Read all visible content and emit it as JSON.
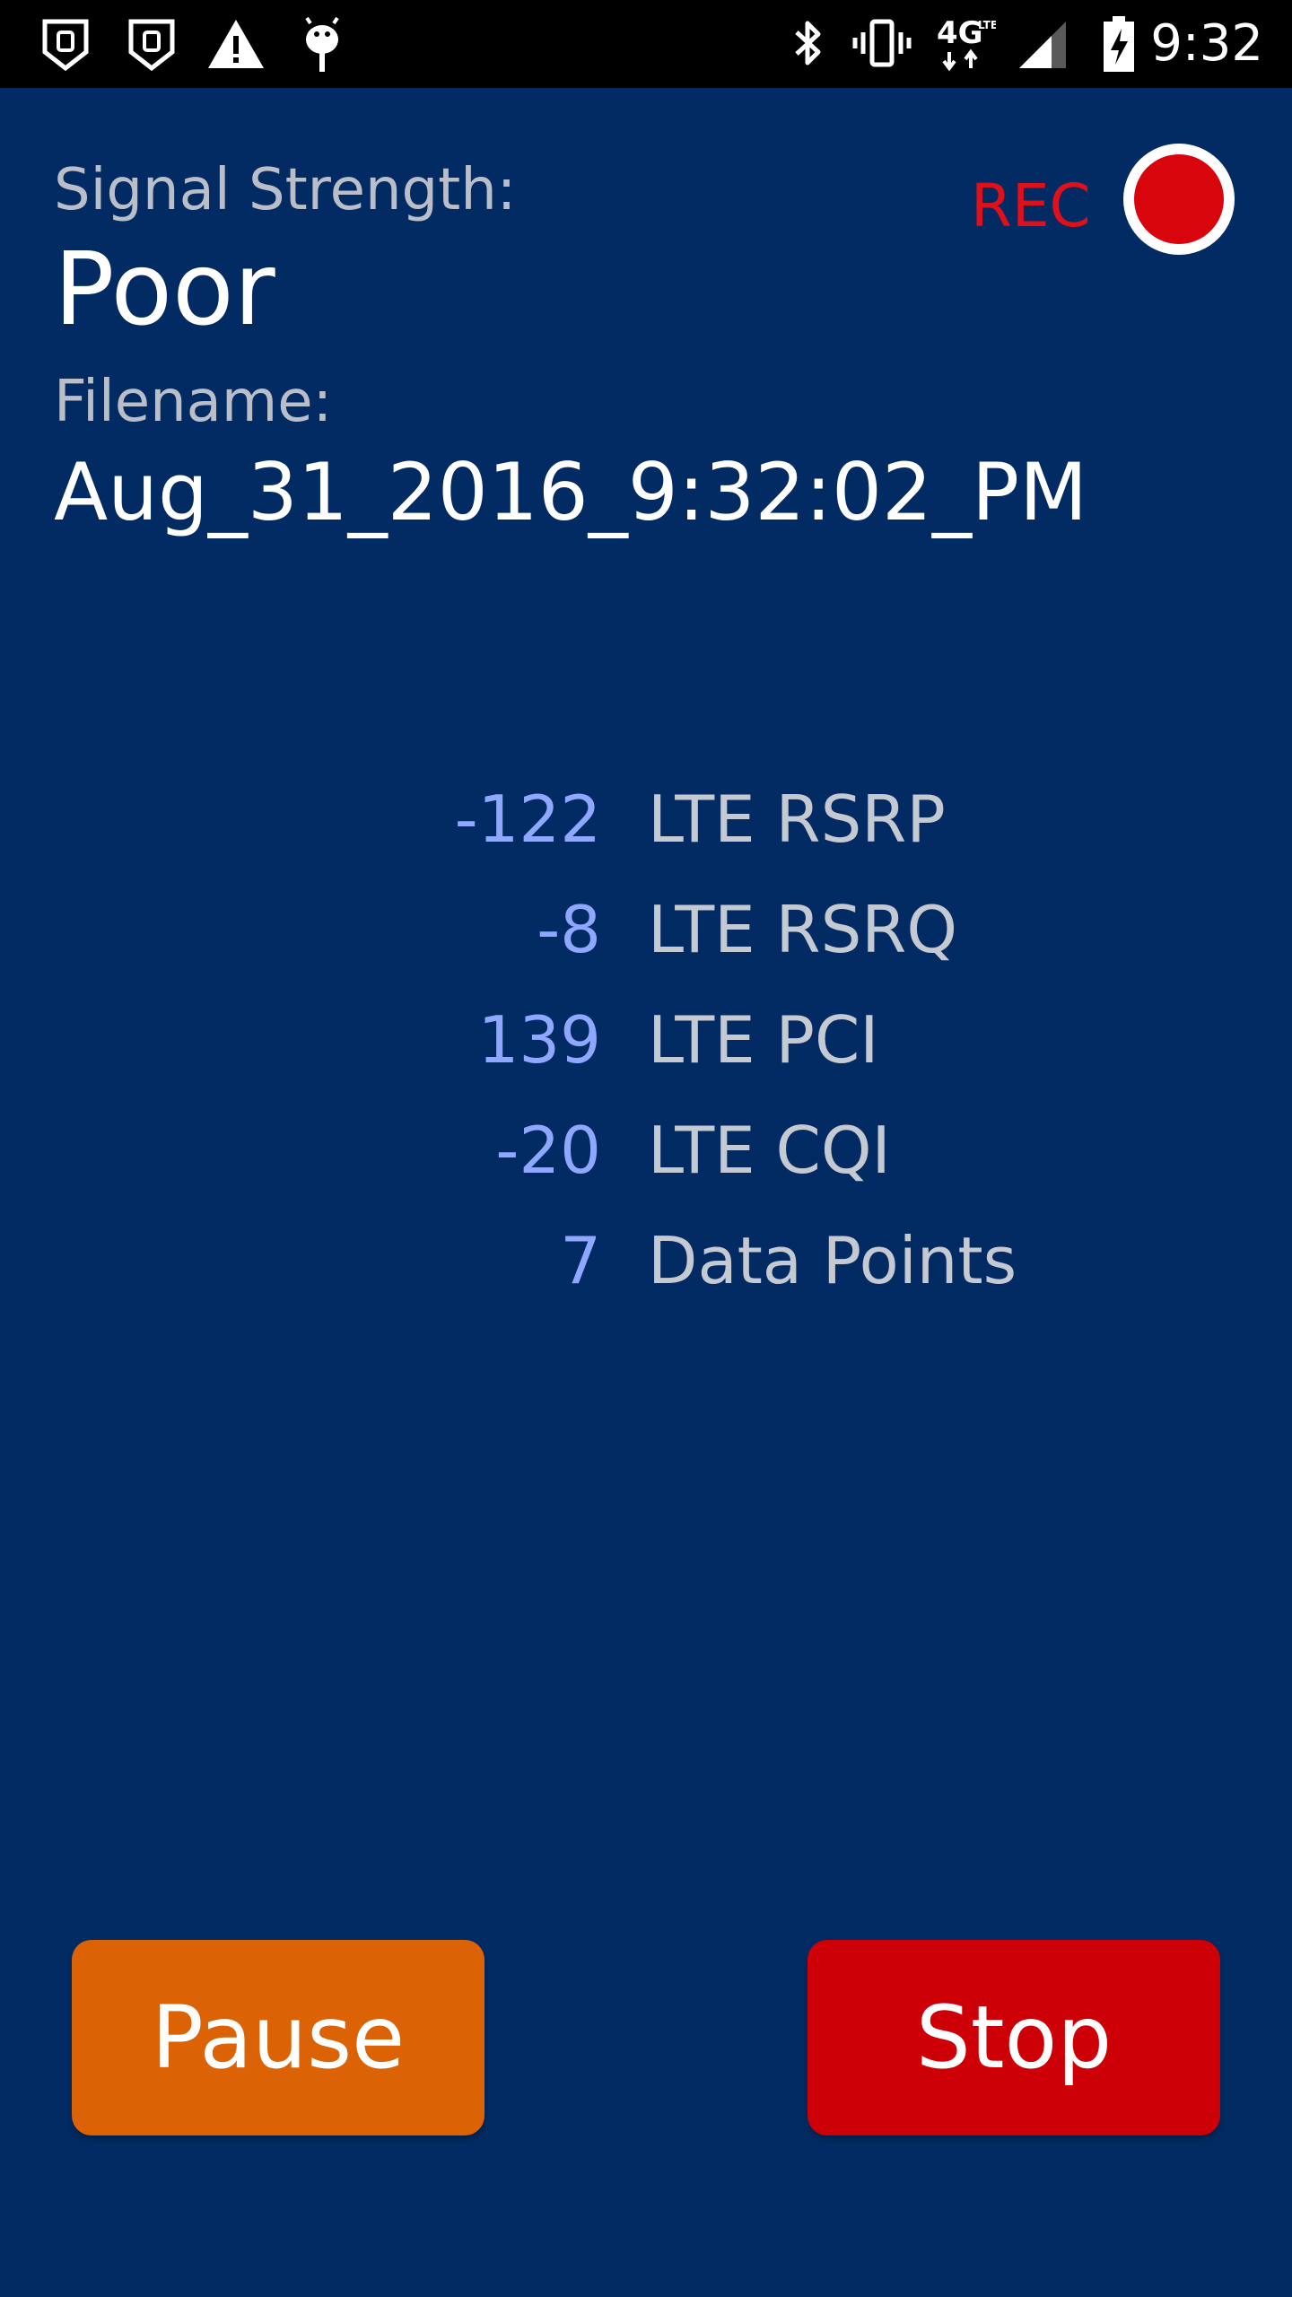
{
  "status_bar": {
    "time": "9:32",
    "network_type": "4G LTE",
    "icons": [
      "shield-icon",
      "shield-icon",
      "warning-icon",
      "android-debug-icon",
      "bluetooth-icon",
      "vibrate-icon",
      "lte-data-icon",
      "cell-signal-icon",
      "battery-charging-icon"
    ]
  },
  "signal": {
    "label": "Signal Strength:",
    "value": "Poor"
  },
  "file": {
    "label": "Filename:",
    "value": "Aug_31_2016_9:32:02_PM"
  },
  "recording": {
    "label": "REC",
    "color": "#e0101a"
  },
  "metrics": [
    {
      "value": "-122",
      "label": "LTE RSRP"
    },
    {
      "value": "-8",
      "label": "LTE RSRQ"
    },
    {
      "value": "139",
      "label": "LTE PCI"
    },
    {
      "value": "-20",
      "label": "LTE CQI"
    },
    {
      "value": "7",
      "label": "Data Points"
    }
  ],
  "buttons": {
    "pause_label": "Pause",
    "stop_label": "Stop"
  },
  "colors": {
    "background": "#022b63",
    "pause": "#db6205",
    "stop": "#cc0006",
    "metric_value": "#8fa7ff"
  }
}
